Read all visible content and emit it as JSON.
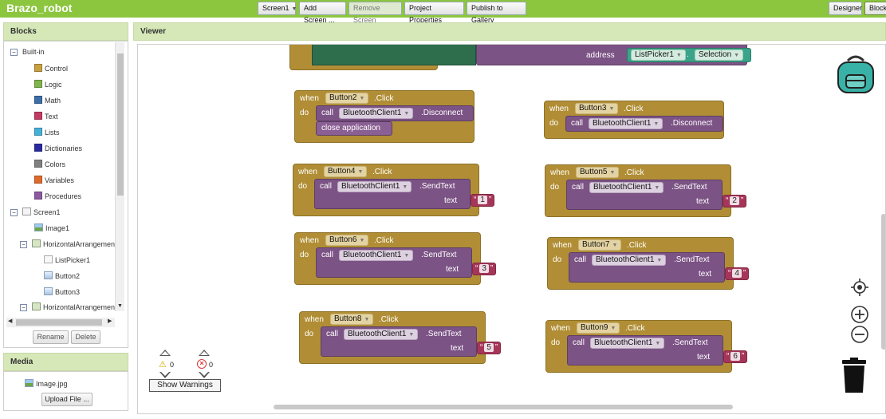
{
  "app": {
    "title": "Brazo_robot"
  },
  "toolbar": {
    "screen_select": "Screen1",
    "add_screen": "Add Screen ...",
    "remove_screen": "Remove Screen",
    "project_properties": "Project Properties",
    "publish": "Publish to Gallery",
    "designer": "Designer",
    "blocks": "Blocks"
  },
  "blocks_panel": {
    "title": "Blocks",
    "builtin": "Built-in",
    "builtin_items": [
      {
        "label": "Control",
        "color": "#c8a040"
      },
      {
        "label": "Logic",
        "color": "#7fb54a"
      },
      {
        "label": "Math",
        "color": "#3d6ea8"
      },
      {
        "label": "Text",
        "color": "#c33b63"
      },
      {
        "label": "Lists",
        "color": "#45b1d8"
      },
      {
        "label": "Dictionaries",
        "color": "#2a2aa0"
      },
      {
        "label": "Colors",
        "color": "#808080"
      },
      {
        "label": "Variables",
        "color": "#e06a2a"
      },
      {
        "label": "Procedures",
        "color": "#8c5aa0"
      }
    ],
    "screen": "Screen1",
    "components": {
      "image1": "Image1",
      "harr1": "HorizontalArrangemen",
      "listpicker1": "ListPicker1",
      "button2": "Button2",
      "button3": "Button3",
      "harr2": "HorizontalArrangemen"
    },
    "rename": "Rename",
    "delete": "Delete"
  },
  "media_panel": {
    "title": "Media",
    "file": "Image.jpg",
    "upload": "Upload File ..."
  },
  "viewer": {
    "title": "Viewer",
    "address_label": "address",
    "listpicker": "ListPicker1",
    "selection": "Selection",
    "when": "when",
    "do": "do",
    "call": "call",
    "click": ".Click",
    "client": "BluetoothClient1",
    "disconnect": ".Disconnect",
    "sendtext": ".SendText",
    "text_label": "text",
    "close_app": "close application",
    "b2": "Button2",
    "b3": "Button3",
    "b4": "Button4",
    "b5": "Button5",
    "b6": "Button6",
    "b7": "Button7",
    "b8": "Button8",
    "b9": "Button9",
    "s1": "1",
    "s2": "2",
    "s3": "3",
    "s4": "4",
    "s5": "5",
    "s6": "6",
    "warnings_count": "0",
    "errors_count": "0",
    "show_warnings": "Show Warnings"
  }
}
